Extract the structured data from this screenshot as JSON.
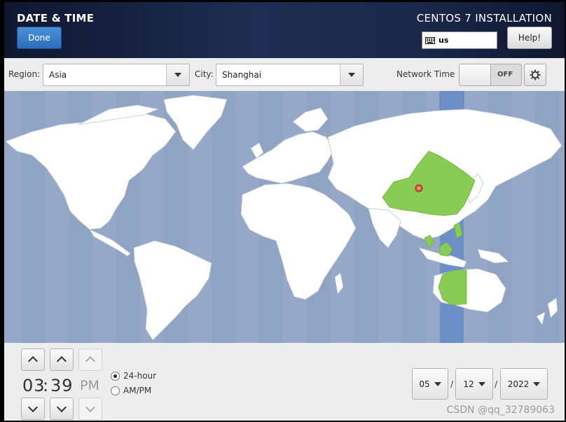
{
  "header": {
    "title": "DATE & TIME",
    "done_label": "Done",
    "install_title": "CENTOS 7 INSTALLATION",
    "keyboard_layout": "us",
    "help_label": "Help!"
  },
  "region_bar": {
    "region_label": "Region:",
    "region_value": "Asia",
    "city_label": "City:",
    "city_value": "Shanghai",
    "network_time_label": "Network Time",
    "network_time_state": "OFF"
  },
  "map": {
    "ocean_color": "#95a8c8",
    "land_color": "#ffffff",
    "selected_timezone_color": "#88cc55",
    "selected_band_color": "#6d8fc8",
    "marker_color": "#e05a4a"
  },
  "time": {
    "hours": "03",
    "separator": ":",
    "minutes": "39",
    "ampm": "PM",
    "format_24_label": "24-hour",
    "format_ampm_label": "AM/PM",
    "selected_format": "24-hour"
  },
  "date": {
    "month": "05",
    "day": "12",
    "year": "2022",
    "separator": "/"
  },
  "watermark": "CSDN @qq_32789063"
}
